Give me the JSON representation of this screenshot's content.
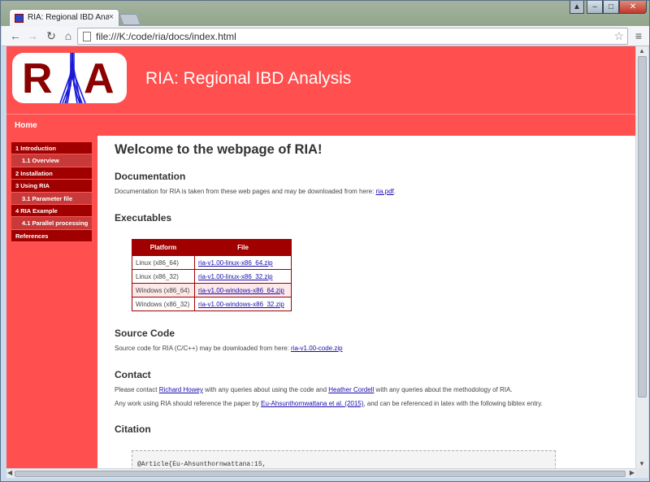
{
  "browser": {
    "tab_title": "RIA: Regional IBD Analysis",
    "tab_close": "×",
    "url": "file:///K:/code/ria/docs/index.html",
    "window_buttons": {
      "user": "▲",
      "min": "–",
      "max": "□",
      "close": "✕"
    },
    "nav_icons": {
      "back": "←",
      "forward": "→",
      "reload": "↻",
      "home": "⌂",
      "star": "☆",
      "menu": "≡"
    }
  },
  "site": {
    "logo": {
      "left": "R",
      "right": "A"
    },
    "title": "RIA: Regional IBD Analysis",
    "nav_home": "Home"
  },
  "sidebar": {
    "items": [
      {
        "label": "1 Introduction",
        "level": 1
      },
      {
        "label": "1.1 Overview",
        "level": 2
      },
      {
        "label": "2 Installation",
        "level": 1
      },
      {
        "label": "3 Using RIA",
        "level": 1
      },
      {
        "label": "3.1 Parameter file",
        "level": 2
      },
      {
        "label": "4 RIA Example",
        "level": 1
      },
      {
        "label": "4.1 Parallel processing",
        "level": 2
      },
      {
        "label": "References",
        "level": 1
      }
    ]
  },
  "content": {
    "welcome": "Welcome to the webpage of RIA!",
    "documentation": {
      "heading": "Documentation",
      "text": "Documentation for RIA is taken from these web pages and may be downloaded from here: ",
      "link": "ria.pdf",
      "suffix": "."
    },
    "executables": {
      "heading": "Executables",
      "col_platform": "Platform",
      "col_file": "File",
      "rows": [
        {
          "platform": "Linux (x86_64)",
          "file": "ria-v1.00-linux-x86_64.zip"
        },
        {
          "platform": "Linux (x86_32)",
          "file": "ria-v1.00-linux-x86_32.zip"
        },
        {
          "platform": "Windows (x86_64)",
          "file": "ria-v1.00-windows-x86_64.zip"
        },
        {
          "platform": "Windows (x86_32)",
          "file": "ria-v1.00-windows-x86_32.zip"
        }
      ]
    },
    "source": {
      "heading": "Source Code",
      "text": "Source code for RIA (C/C++) may be downloaded from here: ",
      "link": "ria-v1.00-code.zip"
    },
    "contact": {
      "heading": "Contact",
      "line1_a": "Please contact ",
      "line1_link1": "Richard Howey",
      "line1_b": " with any queries about using the code and ",
      "line1_link2": "Heather Cordell",
      "line1_c": " with any queries about the methodology of RIA.",
      "line2_a": "Any work using RIA should reference the paper by ",
      "line2_link": "Eu-Ahsunthornwattana et al. (2015)",
      "line2_b": ", and can be referenced in latex with the following bibtex entry."
    },
    "citation": {
      "heading": "Citation",
      "code": "@Article{Eu-Ahsunthornwattana:15,"
    }
  }
}
